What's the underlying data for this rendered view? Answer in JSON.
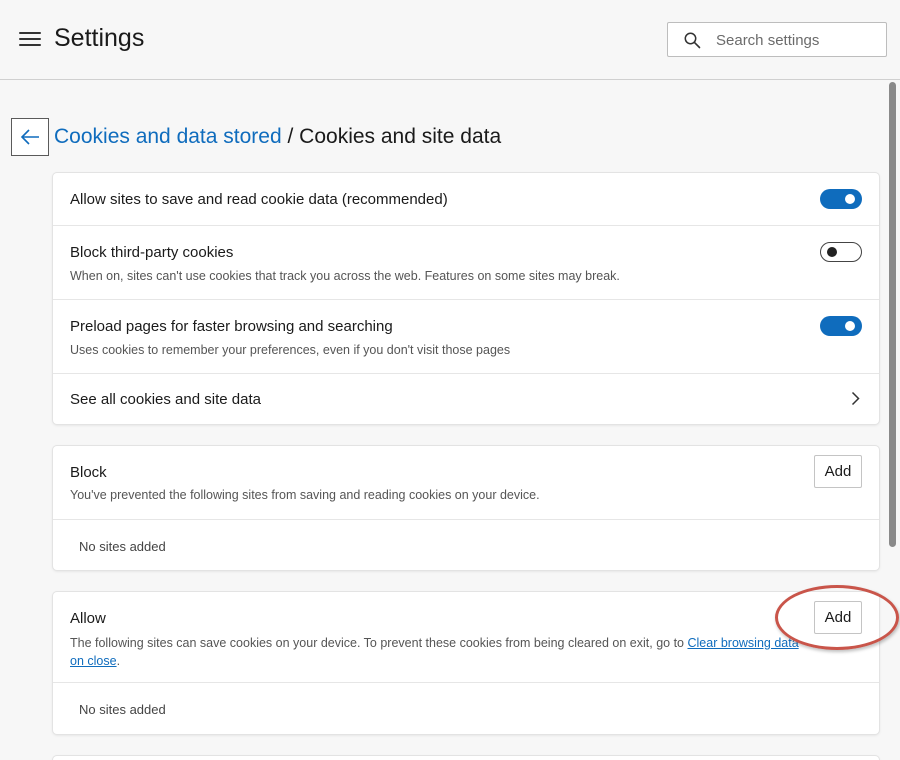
{
  "header": {
    "title": "Settings",
    "search_placeholder": "Search settings"
  },
  "breadcrumb": {
    "parent": "Cookies and data stored",
    "separator": " / ",
    "current": "Cookies and site data"
  },
  "settings": {
    "allow_save": {
      "title": "Allow sites to save and read cookie data (recommended)",
      "enabled": true
    },
    "block_third_party": {
      "title": "Block third-party cookies",
      "description": "When on, sites can't use cookies that track you across the web. Features on some sites may break.",
      "enabled": false
    },
    "preload": {
      "title": "Preload pages for faster browsing and searching",
      "description": "Uses cookies to remember your preferences, even if you don't visit those pages",
      "enabled": true
    },
    "see_all": {
      "title": "See all cookies and site data"
    }
  },
  "block_section": {
    "title": "Block",
    "description": "You've prevented the following sites from saving and reading cookies on your device.",
    "add_label": "Add",
    "empty_text": "No sites added"
  },
  "allow_section": {
    "title": "Allow",
    "description_prefix": "The following sites can save cookies on your device. To prevent these cookies from being cleared on exit, go to ",
    "link_text_1": "Clear browsing data",
    "link_text_2": "on close",
    "description_suffix": ".",
    "add_label": "Add",
    "empty_text": "No sites added"
  },
  "colors": {
    "accent": "#0f6cbd",
    "highlight_ring": "#c9554a"
  }
}
